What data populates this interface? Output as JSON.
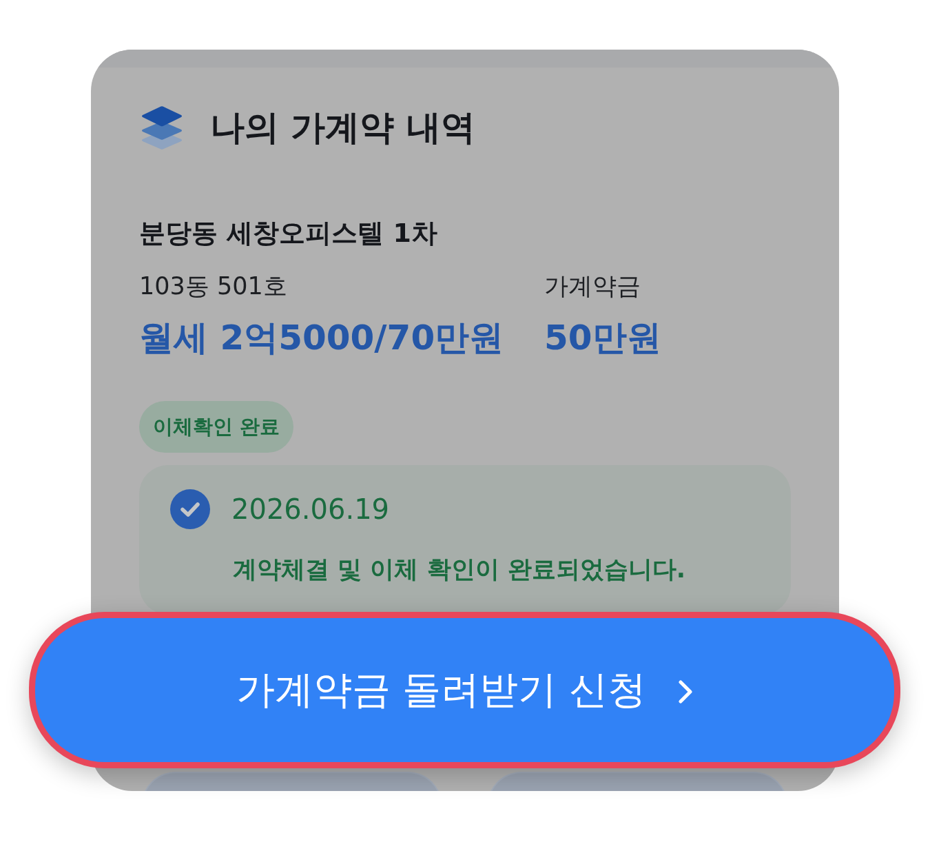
{
  "header": {
    "title": "나의 가계약 내역"
  },
  "contract": {
    "property_name": "분당동 세창오피스텔 1차",
    "unit": "103동 501호",
    "rent_terms": "월세 2억5000/70만원",
    "deposit_label": "가계약금",
    "deposit_amount": "50만원",
    "status_badge": "이체확인 완료",
    "status": {
      "checked": true,
      "date": "2026.06.19",
      "message": "계약체결 및 이체 확인이 완료되었습니다."
    }
  },
  "refund_button": {
    "label": "가계약금 돌려받기 신청",
    "highlighted": true
  }
}
